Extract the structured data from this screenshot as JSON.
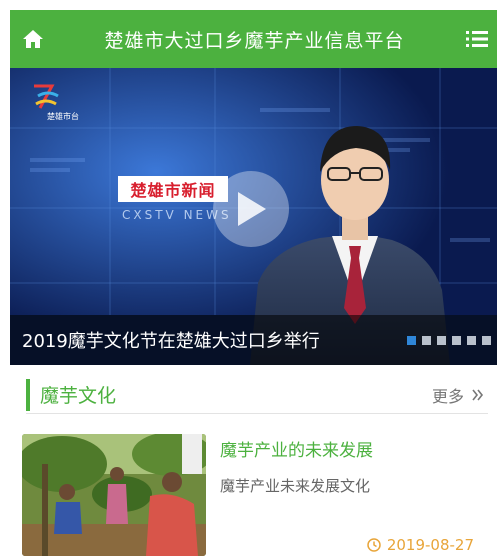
{
  "header": {
    "title": "楚雄市大过口乡魔芋产业信息平台",
    "home_icon": "home-icon",
    "menu_icon": "menu-icon",
    "color": "#4cb13f"
  },
  "banner": {
    "caption": "2019魔芋文化节在楚雄大过口乡举行",
    "station_logo": "楚雄市台",
    "news_label": "楚雄市新闻",
    "news_sub": "CXSTV NEWS",
    "slide_count": 6,
    "active_slide": 1,
    "active_dot_color": "#2f86d8"
  },
  "section": {
    "title": "魔芋文化",
    "more_label": "更多",
    "more_icon": "double-chevron-right-icon"
  },
  "articles": [
    {
      "title": "魔芋产业的未来发展",
      "summary": "魔芋产业未来发展文化",
      "date": "2019-08-27",
      "date_icon": "clock-icon",
      "date_color": "#e8a53a"
    }
  ]
}
